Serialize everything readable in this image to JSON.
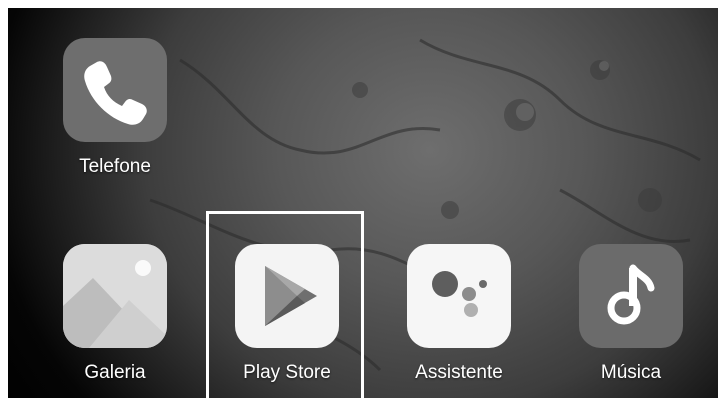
{
  "wallpaper": "planet",
  "apps": [
    {
      "id": "telefone",
      "label": "Telefone",
      "icon": "phone-icon"
    },
    {
      "id": "galeria",
      "label": "Galeria",
      "icon": "gallery-icon"
    },
    {
      "id": "play-store",
      "label": "Play Store",
      "icon": "play-store-icon",
      "highlighted": true
    },
    {
      "id": "assistente",
      "label": "Assistente",
      "icon": "assistant-icon"
    },
    {
      "id": "musica",
      "label": "Música",
      "icon": "music-icon"
    }
  ],
  "colors": {
    "icon_dark": "#6b6b6b",
    "icon_light": "#f2f2f2",
    "highlight": "#ffffff"
  }
}
